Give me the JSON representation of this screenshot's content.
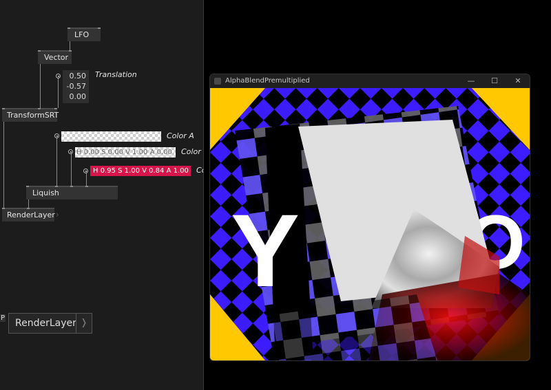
{
  "patch": {
    "nodes": {
      "lfo": "LFO",
      "vector": "Vector",
      "transform": "TransformSRT",
      "liquish": "Liquish",
      "render_layer": "RenderLayer",
      "render_layer_big": "RenderLayer"
    },
    "translation": {
      "values": [
        "0.50",
        "-0.57",
        "0.00"
      ],
      "label": "Translation"
    },
    "colors": {
      "a_label": "Color A",
      "b_label": "Color B",
      "b_value": "H 0.00 S 0.00 V 1.00 A 0.00",
      "c_label": "Co",
      "c_value": "H 0.95 S 1.00 V 0.84 A 1.00",
      "c_hex": "#d6154a"
    },
    "partial_label": "P",
    "output_arrow": "❭",
    "side_arrow": "›"
  },
  "render_window": {
    "title": "AlphaBlendPremultiplied",
    "buttons": {
      "minimize": "—",
      "maximize": "☐",
      "close": "✕"
    },
    "colors": {
      "background": "#ffc800",
      "diamond": "#3d1cff",
      "dark": "#000000",
      "panel": "#e0e0e0"
    },
    "overlay_text": {
      "left": "Y",
      "right": "O"
    }
  }
}
